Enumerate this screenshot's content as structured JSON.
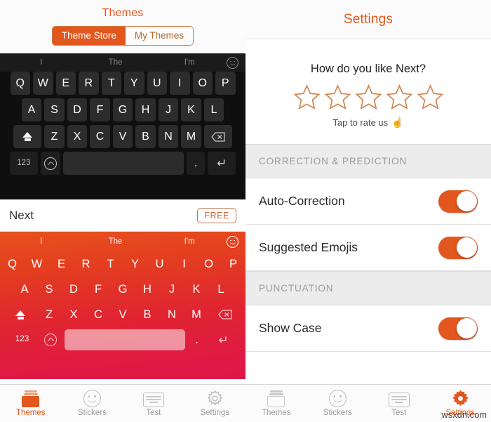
{
  "left_panel": {
    "nav": {
      "title": "Themes",
      "segments": [
        {
          "label": "Theme Store",
          "active": true
        },
        {
          "label": "My Themes",
          "active": false
        }
      ]
    },
    "keyboard_dark": {
      "suggestions": [
        "I",
        "The",
        "I'm"
      ],
      "emoji_icon": "smiley-icon",
      "row1": [
        "Q",
        "W",
        "E",
        "R",
        "T",
        "Y",
        "U",
        "I",
        "O",
        "P"
      ],
      "row2": [
        "A",
        "S",
        "D",
        "F",
        "G",
        "H",
        "J",
        "K",
        "L"
      ],
      "row3": [
        "Z",
        "X",
        "C",
        "V",
        "B",
        "N",
        "M"
      ],
      "shift_icon": "shift-icon",
      "backspace_icon": "backspace-icon",
      "numeric_label": "123",
      "wave_icon": "wave-icon",
      "space_label": "",
      "period_label": ".",
      "return_icon": "return-icon"
    },
    "theme_item": {
      "name": "Next",
      "price_badge": "FREE"
    },
    "keyboard_orange": {
      "suggestions": [
        "I",
        "The",
        "I'm"
      ],
      "emoji_icon": "smiley-icon",
      "row1": [
        "Q",
        "W",
        "E",
        "R",
        "T",
        "Y",
        "U",
        "I",
        "O",
        "P"
      ],
      "row2": [
        "A",
        "S",
        "D",
        "F",
        "G",
        "H",
        "J",
        "K",
        "L"
      ],
      "row3": [
        "Z",
        "X",
        "C",
        "V",
        "B",
        "N",
        "M"
      ],
      "shift_icon": "shift-icon",
      "backspace_icon": "backspace-icon",
      "numeric_label": "123",
      "wave_icon": "wave-icon",
      "period_label": ".",
      "return_icon": "return-icon"
    },
    "tabbar": [
      {
        "label": "Themes",
        "icon": "themes-icon",
        "active": true
      },
      {
        "label": "Stickers",
        "icon": "stickers-icon",
        "active": false
      },
      {
        "label": "Test",
        "icon": "keyboard-icon",
        "active": false
      },
      {
        "label": "Settings",
        "icon": "gear-icon",
        "active": false
      }
    ]
  },
  "right_panel": {
    "nav": {
      "title": "Settings"
    },
    "rating": {
      "question": "How do you like Next?",
      "stars_total": 5,
      "stars_filled": 0,
      "cta": "Tap to rate us",
      "cta_emoji": "☝"
    },
    "sections": [
      {
        "header": "CORRECTION & PREDICTION",
        "rows": [
          {
            "label": "Auto-Correction",
            "toggle": "on"
          },
          {
            "label": "Suggested Emojis",
            "toggle": "on"
          }
        ]
      },
      {
        "header": "PUNCTUATION",
        "rows": [
          {
            "label": "Show Case",
            "toggle": "on"
          }
        ]
      }
    ],
    "tabbar": [
      {
        "label": "Themes",
        "icon": "themes-icon",
        "active": false
      },
      {
        "label": "Stickers",
        "icon": "stickers-icon",
        "active": false
      },
      {
        "label": "Test",
        "icon": "keyboard-icon",
        "active": false
      },
      {
        "label": "Settings",
        "icon": "gear-icon",
        "active": true
      }
    ]
  },
  "watermark": {
    "text": "wsxdn.com"
  },
  "colors": {
    "accent": "#E2571E",
    "keyboard_gradient_start": "#E8511F",
    "keyboard_gradient_end": "#DF1748",
    "dark_keyboard_bg": "#0f0f0f",
    "section_header_bg": "#ececec"
  }
}
